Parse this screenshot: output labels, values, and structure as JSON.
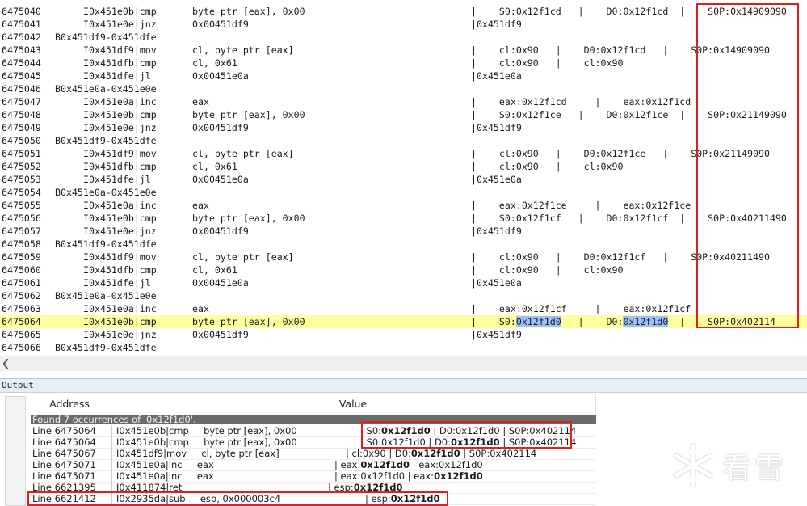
{
  "trace": {
    "rows": [
      {
        "ln": "6475040",
        "addr": "I0x451e0b|cmp",
        "op": "byte ptr [eax], 0x00",
        "reg": "|    S0:0x12f1cd   |    D0:0x12f1cd  |    S0P:0x14909090"
      },
      {
        "ln": "6475041",
        "addr": "I0x451e0e|jnz",
        "op": "0x00451df9",
        "reg": "|0x451df9"
      },
      {
        "ln": "6475042",
        "lbl": "B0x451df9-0x451dfe"
      },
      {
        "ln": "6475043",
        "addr": "I0x451df9|mov",
        "op": "cl, byte ptr [eax]",
        "reg": "|    cl:0x90   |    D0:0x12f1cd   |    S0P:0x14909090"
      },
      {
        "ln": "6475044",
        "addr": "I0x451dfb|cmp",
        "op": "cl, 0x61",
        "reg": "|    cl:0x90   |    cl:0x90"
      },
      {
        "ln": "6475045",
        "addr": "I0x451dfe|jl",
        "op": "0x00451e0a",
        "reg": "|0x451e0a"
      },
      {
        "ln": "6475046",
        "lbl": "B0x451e0a-0x451e0e"
      },
      {
        "ln": "6475047",
        "addr": "I0x451e0a|inc",
        "op": "eax",
        "reg": "|    eax:0x12f1cd     |    eax:0x12f1cd"
      },
      {
        "ln": "6475048",
        "addr": "I0x451e0b|cmp",
        "op": "byte ptr [eax], 0x00",
        "reg": "|    S0:0x12f1ce   |    D0:0x12f1ce  |    S0P:0x21149090"
      },
      {
        "ln": "6475049",
        "addr": "I0x451e0e|jnz",
        "op": "0x00451df9",
        "reg": "|0x451df9"
      },
      {
        "ln": "6475050",
        "lbl": "B0x451df9-0x451dfe"
      },
      {
        "ln": "6475051",
        "addr": "I0x451df9|mov",
        "op": "cl, byte ptr [eax]",
        "reg": "|    cl:0x90   |    D0:0x12f1ce   |    S0P:0x21149090"
      },
      {
        "ln": "6475052",
        "addr": "I0x451dfb|cmp",
        "op": "cl, 0x61",
        "reg": "|    cl:0x90   |    cl:0x90"
      },
      {
        "ln": "6475053",
        "addr": "I0x451dfe|jl",
        "op": "0x00451e0a",
        "reg": "|0x451e0a"
      },
      {
        "ln": "6475054",
        "lbl": "B0x451e0a-0x451e0e"
      },
      {
        "ln": "6475055",
        "addr": "I0x451e0a|inc",
        "op": "eax",
        "reg": "|    eax:0x12f1ce     |    eax:0x12f1ce"
      },
      {
        "ln": "6475056",
        "addr": "I0x451e0b|cmp",
        "op": "byte ptr [eax], 0x00",
        "reg": "|    S0:0x12f1cf   |    D0:0x12f1cf  |    S0P:0x40211490"
      },
      {
        "ln": "6475057",
        "addr": "I0x451e0e|jnz",
        "op": "0x00451df9",
        "reg": "|0x451df9"
      },
      {
        "ln": "6475058",
        "lbl": "B0x451df9-0x451dfe"
      },
      {
        "ln": "6475059",
        "addr": "I0x451df9|mov",
        "op": "cl, byte ptr [eax]",
        "reg": "|    cl:0x90   |    D0:0x12f1cf   |    S0P:0x40211490"
      },
      {
        "ln": "6475060",
        "addr": "I0x451dfb|cmp",
        "op": "cl, 0x61",
        "reg": "|    cl:0x90   |    cl:0x90"
      },
      {
        "ln": "6475061",
        "addr": "I0x451dfe|jl",
        "op": "0x00451e0a",
        "reg": "|0x451e0a"
      },
      {
        "ln": "6475062",
        "lbl": "B0x451e0a-0x451e0e"
      },
      {
        "ln": "6475063",
        "addr": "I0x451e0a|inc",
        "op": "eax",
        "reg": "|    eax:0x12f1cf     |    eax:0x12f1cf"
      },
      {
        "ln": "6475064",
        "addr": "I0x451e0b|cmp",
        "op": "byte ptr [eax], 0x00",
        "reg": "|    S0:0x12f1d0   |    D0:0x12f1d0  |    S0P:0x402114",
        "highlight": true
      },
      {
        "ln": "6475065",
        "addr": "I0x451e0e|jnz",
        "op": "0x00451df9",
        "reg": "|0x451df9"
      },
      {
        "ln": "6475066",
        "lbl": "B0x451df9-0x451dfe"
      }
    ]
  },
  "output": {
    "title": "Output",
    "col_address": "Address",
    "col_value": "Value",
    "found_text": "Found 7 occurrences of '0x12f1d0'.",
    "rows": [
      {
        "line": "Line 6475064",
        "ins": "I0x451e0b|cmp     byte ptr [eax], 0x00",
        "pre": "S0:",
        "b1": "0x12f1d0",
        "mid": " | D0:0x12f1d0 | S0P:0x402114",
        "b2": "",
        "post": ""
      },
      {
        "line": "Line 6475064",
        "ins": "I0x451e0b|cmp     byte ptr [eax], 0x00",
        "pre": "S0:0x12f1d0 | D0:",
        "b1": "0x12f1d0",
        "mid": " | S0P:0x402114",
        "b2": "",
        "post": ""
      },
      {
        "line": "Line 6475067",
        "ins": "I0x451df9|mov     cl, byte ptr [eax]",
        "pre": "cl:0x90 | D0:",
        "b1": "0x12f1d0",
        "mid": " | S0P:0x402114",
        "b2": "",
        "post": ""
      },
      {
        "line": "Line 6475071",
        "ins": "I0x451e0a|inc     eax",
        "pre": "eax:",
        "b1": "0x12f1d0",
        "mid": " | eax:0x12f1d0",
        "b2": "",
        "post": ""
      },
      {
        "line": "Line 6475071",
        "ins": "I0x451e0a|inc     eax",
        "pre": "eax:0x12f1d0 | eax:",
        "b1": "0x12f1d0",
        "mid": "",
        "b2": "",
        "post": ""
      },
      {
        "line": "Line 6621395",
        "ins": "I0x411874|ret",
        "pre": "esp:",
        "b1": "0x12f1d0",
        "mid": "",
        "b2": "",
        "post": ""
      },
      {
        "line": "Line 6621412",
        "ins": "I0x2935da|sub     esp, 0x000003c4",
        "pre": "esp:",
        "b1": "0x12f1d0",
        "mid": "",
        "b2": "",
        "post": ""
      }
    ]
  },
  "watermark": {
    "text": "看雪"
  }
}
